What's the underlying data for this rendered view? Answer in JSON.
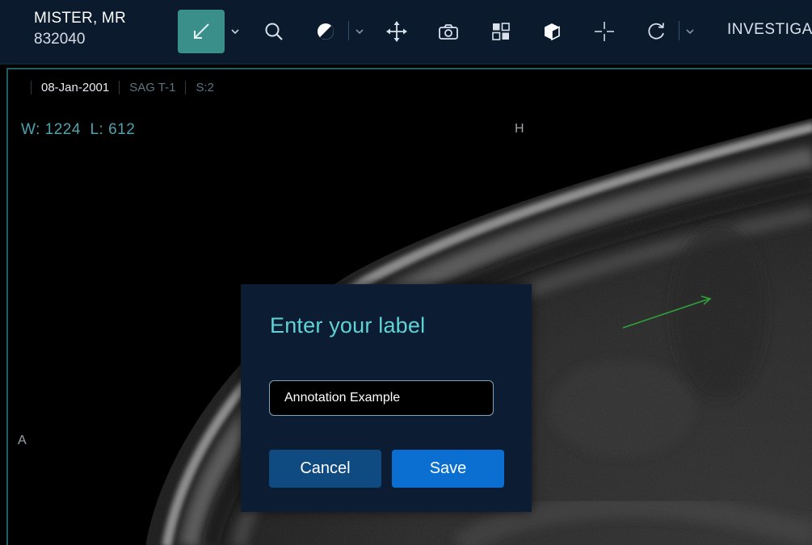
{
  "patient": {
    "name": "MISTER, MR",
    "id": "832040"
  },
  "toolbar": {
    "active_tool_icon": "arrow-annotate-icon",
    "menu_label": "INVESTIGA",
    "accent_color": "#3a8f8b"
  },
  "viewport": {
    "study_date": "08-Jan-2001",
    "series": "SAG T-1",
    "slice": "S:2",
    "window_level": "W: 1224  L: 612",
    "orientation_top": "H",
    "orientation_left": "A"
  },
  "annotation_arrow_color": "#2fa23a",
  "modal": {
    "title": "Enter your label",
    "input_value": "Annotation Example",
    "cancel_label": "Cancel",
    "save_label": "Save"
  }
}
